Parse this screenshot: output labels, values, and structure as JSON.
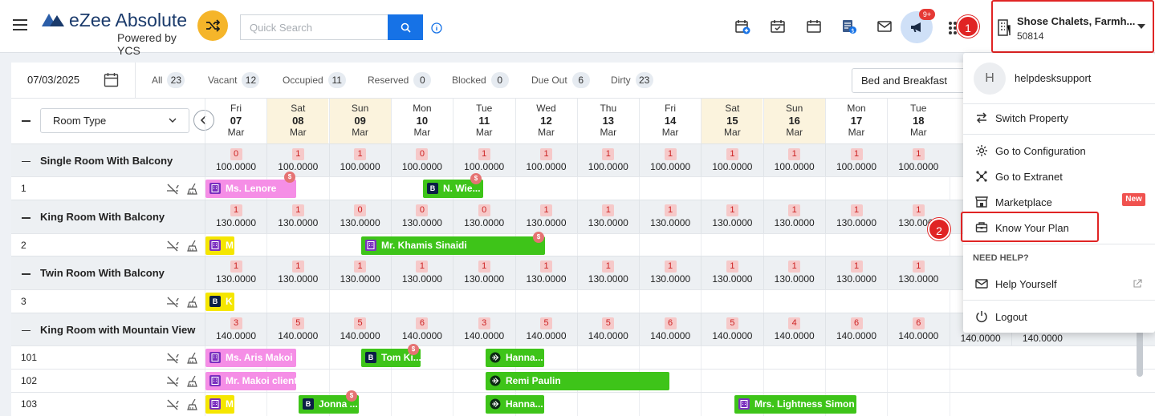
{
  "header": {
    "brand": "eZee Absolute",
    "powered_by": "Powered by YCS",
    "search_placeholder": "Quick Search",
    "notification_count": "9+",
    "property_name": "Shose Chalets, Farmh...",
    "property_id": "50814",
    "step1": "1",
    "step2": "2"
  },
  "filters": {
    "date": "07/03/2025",
    "items": [
      {
        "label": "All",
        "count": "23"
      },
      {
        "label": "Vacant",
        "count": "12"
      },
      {
        "label": "Occupied",
        "count": "11"
      },
      {
        "label": "Reserved",
        "count": "0"
      },
      {
        "label": "Blocked",
        "count": "0"
      },
      {
        "label": "Due Out",
        "count": "6"
      },
      {
        "label": "Dirty",
        "count": "23"
      }
    ],
    "meal_plan": "Bed and Breakfast",
    "room_type_select": "Room Type"
  },
  "dates": [
    {
      "day": "Fri",
      "num": "07",
      "mon": "Mar",
      "weekend": false
    },
    {
      "day": "Sat",
      "num": "08",
      "mon": "Mar",
      "weekend": true
    },
    {
      "day": "Sun",
      "num": "09",
      "mon": "Mar",
      "weekend": true
    },
    {
      "day": "Mon",
      "num": "10",
      "mon": "Mar",
      "weekend": false
    },
    {
      "day": "Tue",
      "num": "11",
      "mon": "Mar",
      "weekend": false
    },
    {
      "day": "Wed",
      "num": "12",
      "mon": "Mar",
      "weekend": false
    },
    {
      "day": "Thu",
      "num": "13",
      "mon": "Mar",
      "weekend": false
    },
    {
      "day": "Fri",
      "num": "14",
      "mon": "Mar",
      "weekend": false
    },
    {
      "day": "Sat",
      "num": "15",
      "mon": "Mar",
      "weekend": true
    },
    {
      "day": "Sun",
      "num": "16",
      "mon": "Mar",
      "weekend": true
    },
    {
      "day": "Mon",
      "num": "17",
      "mon": "Mar",
      "weekend": false
    },
    {
      "day": "Tue",
      "num": "18",
      "mon": "Mar",
      "weekend": false
    }
  ],
  "categories": [
    {
      "name": "Single Room With Balcony",
      "avail": [
        "0",
        "1",
        "1",
        "0",
        "1",
        "1",
        "1",
        "1",
        "1",
        "1",
        "1",
        "1"
      ],
      "rate": "100.0000"
    },
    {
      "name": "King Room With Balcony",
      "avail": [
        "1",
        "1",
        "0",
        "0",
        "0",
        "1",
        "1",
        "1",
        "1",
        "1",
        "1",
        "1"
      ],
      "rate": "130.0000"
    },
    {
      "name": "Twin Room With Balcony",
      "avail": [
        "1",
        "1",
        "1",
        "1",
        "1",
        "1",
        "1",
        "1",
        "1",
        "1",
        "1",
        "1"
      ],
      "rate": "130.0000"
    },
    {
      "name": "King Room with Mountain View",
      "avail": [
        "3",
        "5",
        "5",
        "6",
        "3",
        "5",
        "5",
        "6",
        "5",
        "4",
        "6",
        "6"
      ],
      "rate": "140.0000"
    }
  ],
  "extra_rates": [
    "140.0000",
    "140.0000"
  ],
  "rooms": [
    {
      "number": "1",
      "bookings": [
        {
          "guest": "Ms. Lenore",
          "color": "#f58ee6",
          "icon": "hotel-icon"
        },
        {
          "guest": "N. Wie...",
          "color": "#3ec419",
          "icon": "booking-icon"
        }
      ]
    },
    {
      "number": "2",
      "bookings": [
        {
          "guest": "M",
          "color": "#f5e600",
          "icon": "hotel-icon"
        },
        {
          "guest": "Mr. Khamis Sinaidi",
          "color": "#3ec419",
          "icon": "hotel-icon"
        }
      ]
    },
    {
      "number": "3",
      "bookings": [
        {
          "guest": "K",
          "color": "#f5e600",
          "icon": "booking-icon"
        }
      ]
    },
    {
      "number": "101",
      "bookings": [
        {
          "guest": "Ms. Aris Makoi",
          "color": "#f58ee6",
          "icon": "hotel-icon"
        },
        {
          "guest": "Tom Ki...",
          "color": "#3ec419",
          "icon": "booking-icon"
        },
        {
          "guest": "Hanna...",
          "color": "#3ec419",
          "icon": "plane-icon"
        }
      ]
    },
    {
      "number": "102",
      "bookings": [
        {
          "guest": "Mr. Makoi client",
          "color": "#f58ee6",
          "icon": "hotel-icon"
        },
        {
          "guest": "Remi Paulin",
          "color": "#3ec419",
          "icon": "plane-icon"
        }
      ]
    },
    {
      "number": "103",
      "bookings": [
        {
          "guest": "M",
          "color": "#f5e600",
          "icon": "hotel-icon"
        },
        {
          "guest": "Jonna ...",
          "color": "#3ec419",
          "icon": "booking-icon"
        },
        {
          "guest": "Hanna...",
          "color": "#3ec419",
          "icon": "plane-icon"
        },
        {
          "guest": "Mrs. Lightness Simon",
          "color": "#3ec419",
          "icon": "hotel-icon"
        }
      ]
    }
  ],
  "menu": {
    "avatar_letter": "H",
    "username": "helpdesksupport",
    "switch_property": "Switch Property",
    "configuration": "Go to Configuration",
    "extranet": "Go to Extranet",
    "marketplace": "Marketplace",
    "new_badge": "New",
    "know_your_plan": "Know Your Plan",
    "need_help": "NEED HELP?",
    "help_yourself": "Help Yourself",
    "logout": "Logout"
  },
  "colors": {
    "accent": "#1672e6",
    "highlight": "#e02424",
    "booked_green": "#3ec419",
    "booked_pink": "#f58ee6",
    "booked_yellow": "#f5e600",
    "weekend": "#fbf3dd"
  }
}
